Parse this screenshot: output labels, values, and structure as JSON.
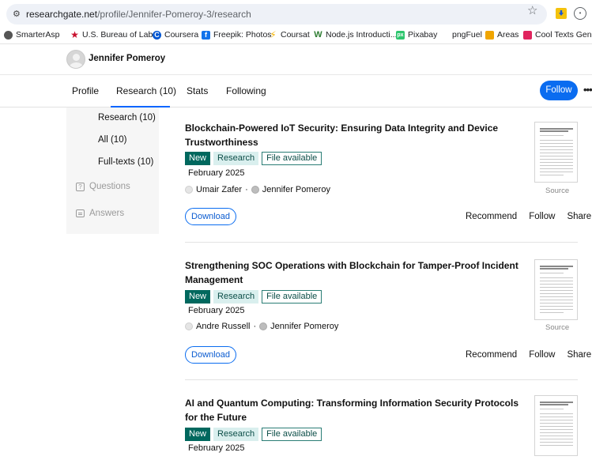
{
  "browser": {
    "url_host": "researchgate.net",
    "url_path": "/profile/Jennifer-Pomeroy-3/research",
    "bookmarks": [
      {
        "label": "SmarterAsp",
        "icon": "globe-icon",
        "color": "#555555"
      },
      {
        "label": "U.S. Bureau of Lab...",
        "icon": "star-flag-icon",
        "color": "#c8102e"
      },
      {
        "label": "Coursera",
        "icon": "coursera-icon",
        "color": "#0056d2"
      },
      {
        "label": "Freepik: Photos",
        "icon": "freepik-icon",
        "color": "#1273eb"
      },
      {
        "label": "Coursat",
        "icon": "coursat-icon",
        "color": "#f5b400"
      },
      {
        "label": "Node.js Introducti...",
        "icon": "node-icon",
        "color": "#2e7d32"
      },
      {
        "label": "Pixabay",
        "icon": "pixabay-icon",
        "color": "#2ec66e"
      },
      {
        "label": "pngFuel",
        "icon": "",
        "color": "#ffffff"
      },
      {
        "label": "Areas",
        "icon": "areas-icon",
        "color": "#f0a500"
      },
      {
        "label": "Cool Texts Genera",
        "icon": "cooltext-icon",
        "color": "#e0245e"
      }
    ]
  },
  "profile": {
    "name": "Jennifer Pomeroy"
  },
  "tabs": [
    {
      "label": "Profile"
    },
    {
      "label": "Research (10)"
    },
    {
      "label": "Stats"
    },
    {
      "label": "Following"
    }
  ],
  "follow_label": "Follow",
  "more_label": "•••",
  "subnav": {
    "items": [
      {
        "label": "Research (10)"
      },
      {
        "label": "All (10)"
      },
      {
        "label": "Full-texts (10)"
      }
    ],
    "questions": "Questions",
    "answers": "Answers"
  },
  "badges": {
    "new": "New",
    "type": "Research",
    "file": "File available"
  },
  "actions": {
    "download": "Download",
    "recommend": "Recommend",
    "follow": "Follow",
    "share": "Share",
    "source": "Source"
  },
  "publications": [
    {
      "title": "Blockchain-Powered IoT Security: Ensuring Data Integrity and Device Trustworthiness",
      "date": "February 2025",
      "author1": "Umair Zafer",
      "author2": "Jennifer Pomeroy"
    },
    {
      "title": "Strengthening SOC Operations with Blockchain for Tamper-Proof Incident Management",
      "date": "February 2025",
      "author1": "Andre Russell",
      "author2": "Jennifer Pomeroy"
    },
    {
      "title": "AI and Quantum Computing: Transforming Information Security Protocols for the Future",
      "date": "February 2025"
    }
  ],
  "colors": {
    "accent": "#0a6cf0",
    "badge_new": "#00685e",
    "badge_type_bg": "#d9efee"
  }
}
